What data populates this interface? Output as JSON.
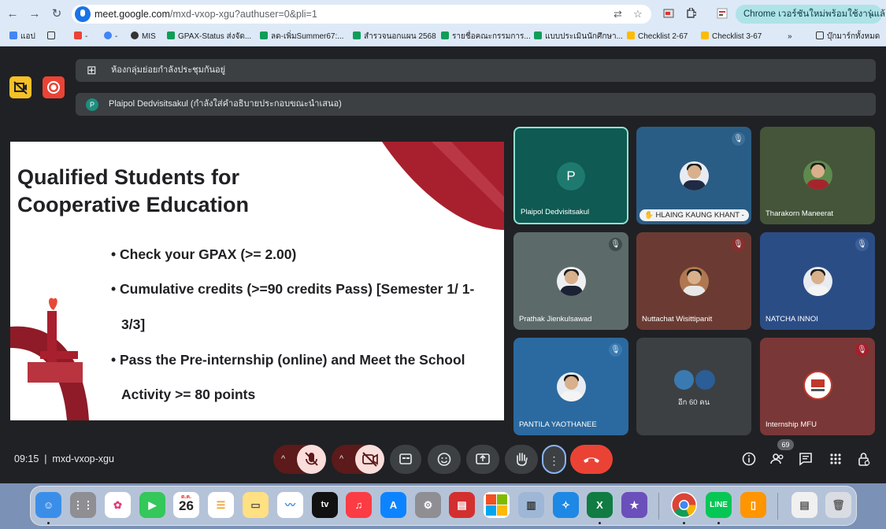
{
  "browser": {
    "url_host": "meet.google.com",
    "url_path": "/mxd-vxop-xgu?authuser=0&pli=1",
    "update_button": "Chrome เวอร์ชันใหม่พร้อมใช้งานแล้ว",
    "bookmarks": [
      "แอป",
      "MIS",
      "GPAX-Status ส่งจัด...",
      "ลด-เพิ่มSummer67:...",
      "สำรวจนอกแผน 2568",
      "รายชื่อคณะกรรมการ...",
      "แบบประเมินนักศึกษา...",
      "Checklist 2-67",
      "Checklist 3-67",
      "บุ๊กมาร์กทั้งหมด"
    ],
    "icons": {
      "back": "arrow-left-icon",
      "forward": "arrow-right-icon",
      "reload": "reload-icon"
    }
  },
  "meet": {
    "banner_breakout": "ห้องกลุ่มย่อยกำลังประชุมกันอยู่",
    "banner_presenter": "Plaipol Dedvisitsakul (กำลังใส่คำอธิบายประกอบขณะนำเสนอ)",
    "presenter_initial": "P",
    "time": "09:15",
    "meeting_code": "mxd-vxop-xgu",
    "participant_count": "69",
    "more_people": "อีก 60 คน"
  },
  "slide": {
    "title_line1": "Qualified Students for",
    "title_line2": "Cooperative Education",
    "bullets": [
      "• Check your GPAX (>= 2.00)",
      "• Cumulative credits (>=90 credits Pass) [Semester 1/ 1-",
      "3/3]",
      "• Pass the Pre-internship (online)  and Meet the School",
      "Activity >= 80 points"
    ]
  },
  "participants": [
    {
      "name": "Plaipol Dedvisitsakul",
      "initial": "P",
      "color": "#0f5a52"
    },
    {
      "name": "HLAING KAUNG KHANT -",
      "color": "#2a5d86"
    },
    {
      "name": "Tharakorn Maneerat",
      "color": "#44553a"
    },
    {
      "name": "Prathak Jienkulsawad",
      "color": "#5c6b6a"
    },
    {
      "name": "Nuttachat Wisittipanit",
      "color": "#6b3b33"
    },
    {
      "name": "NATCHA INNOI",
      "color": "#2b4d86"
    },
    {
      "name": "PANTILA YAOTHANEE",
      "color": "#2b6aa0"
    },
    {
      "name": "อีก 60 คน",
      "color": "#3c4043"
    },
    {
      "name": "Internship MFU",
      "color": "#7a3737"
    }
  ],
  "dock": {
    "calendar_month": "ต.ค.",
    "calendar_day": "26",
    "tv_label": "tv",
    "line_label": "LINE"
  }
}
